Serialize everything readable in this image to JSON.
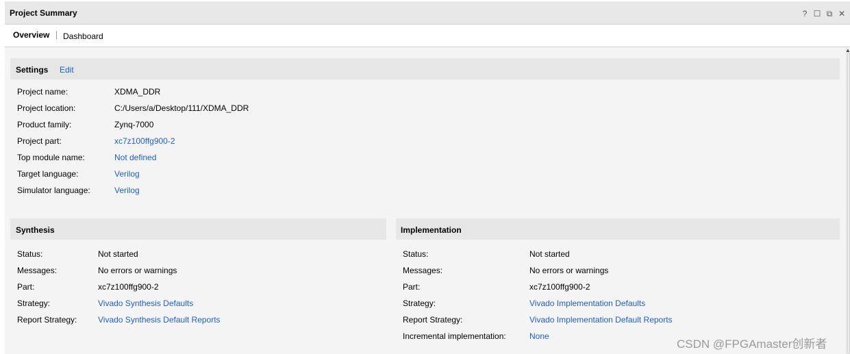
{
  "window": {
    "title": "Project Summary",
    "controls": {
      "help": "?",
      "maximize": "☐",
      "float": "⧉",
      "close": "✕"
    }
  },
  "tabs": [
    {
      "label": "Overview",
      "active": true
    },
    {
      "label": "Dashboard",
      "active": false
    }
  ],
  "settings": {
    "title": "Settings",
    "edit_label": "Edit",
    "rows": [
      {
        "label": "Project name:",
        "value": "XDMA_DDR",
        "link": false
      },
      {
        "label": "Project location:",
        "value": "C:/Users/a/Desktop/111/XDMA_DDR",
        "link": false
      },
      {
        "label": "Product family:",
        "value": "Zynq-7000",
        "link": false
      },
      {
        "label": "Project part:",
        "value": "xc7z100ffg900-2",
        "link": true
      },
      {
        "label": "Top module name:",
        "value": "Not defined",
        "link": true
      },
      {
        "label": "Target language:",
        "value": "Verilog",
        "link": true
      },
      {
        "label": "Simulator language:",
        "value": "Verilog",
        "link": true
      }
    ]
  },
  "synthesis": {
    "title": "Synthesis",
    "rows": [
      {
        "label": "Status:",
        "value": "Not started",
        "link": false
      },
      {
        "label": "Messages:",
        "value": "No errors or warnings",
        "link": false
      },
      {
        "label": "Part:",
        "value": "xc7z100ffg900-2",
        "link": false
      },
      {
        "label": "Strategy:",
        "value": "Vivado Synthesis Defaults",
        "link": true
      },
      {
        "label": "Report Strategy:",
        "value": "Vivado Synthesis Default Reports",
        "link": true
      }
    ]
  },
  "implementation": {
    "title": "Implementation",
    "rows": [
      {
        "label": "Status:",
        "value": "Not started",
        "link": false
      },
      {
        "label": "Messages:",
        "value": "No errors or warnings",
        "link": false
      },
      {
        "label": "Part:",
        "value": "xc7z100ffg900-2",
        "link": false
      },
      {
        "label": "Strategy:",
        "value": "Vivado Implementation Defaults",
        "link": true
      },
      {
        "label": "Report Strategy:",
        "value": "Vivado Implementation Default Reports",
        "link": true
      },
      {
        "label": "Incremental implementation:",
        "value": "None",
        "link": true
      }
    ]
  },
  "watermark": "CSDN @FPGAmaster创新者",
  "colors": {
    "link": "#1f5fbf",
    "section_header": "#e6e6e6",
    "content_bg": "#f4f4f4"
  }
}
